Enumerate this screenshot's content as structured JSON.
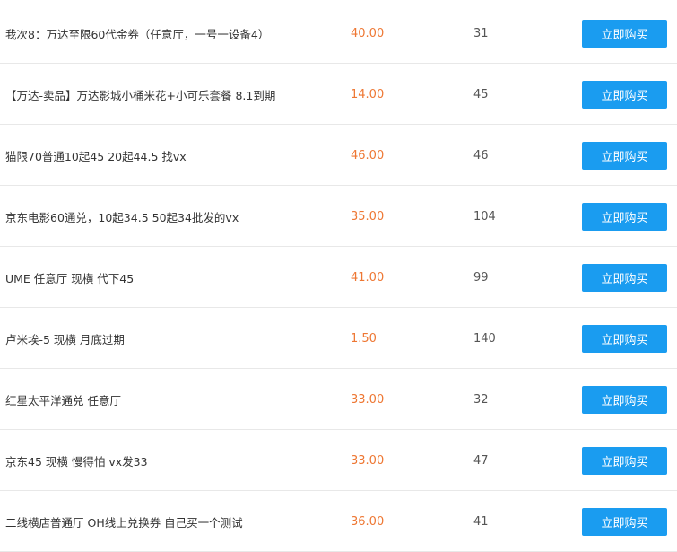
{
  "items": [
    {
      "title": "我次8：万达至限60代金券（任意厅，一号一设备4）",
      "price": "40.00",
      "stock": "31",
      "button": "立即购买"
    },
    {
      "title": "【万达-卖品】万达影城小桶米花+小可乐套餐 8.1到期",
      "price": "14.00",
      "stock": "45",
      "button": "立即购买"
    },
    {
      "title": "猫限70普通10起45 20起44.5 找vx",
      "price": "46.00",
      "stock": "46",
      "button": "立即购买"
    },
    {
      "title": "京东电影60通兑，10起34.5 50起34批发的vx",
      "price": "35.00",
      "stock": "104",
      "button": "立即购买"
    },
    {
      "title": "UME 任意厅 现横 代下45",
      "price": "41.00",
      "stock": "99",
      "button": "立即购买"
    },
    {
      "title": "卢米埃-5 现横 月底过期",
      "price": "1.50",
      "stock": "140",
      "button": "立即购买"
    },
    {
      "title": "红星太平洋通兑 任意厅",
      "price": "33.00",
      "stock": "32",
      "button": "立即购买"
    },
    {
      "title": "京东45 现横 慢得怕 vx发33",
      "price": "33.00",
      "stock": "47",
      "button": "立即购买"
    },
    {
      "title": "二线横店普通厅 OH线上兑换券 自己买一个测试",
      "price": "36.00",
      "stock": "41",
      "button": "立即购买"
    }
  ]
}
